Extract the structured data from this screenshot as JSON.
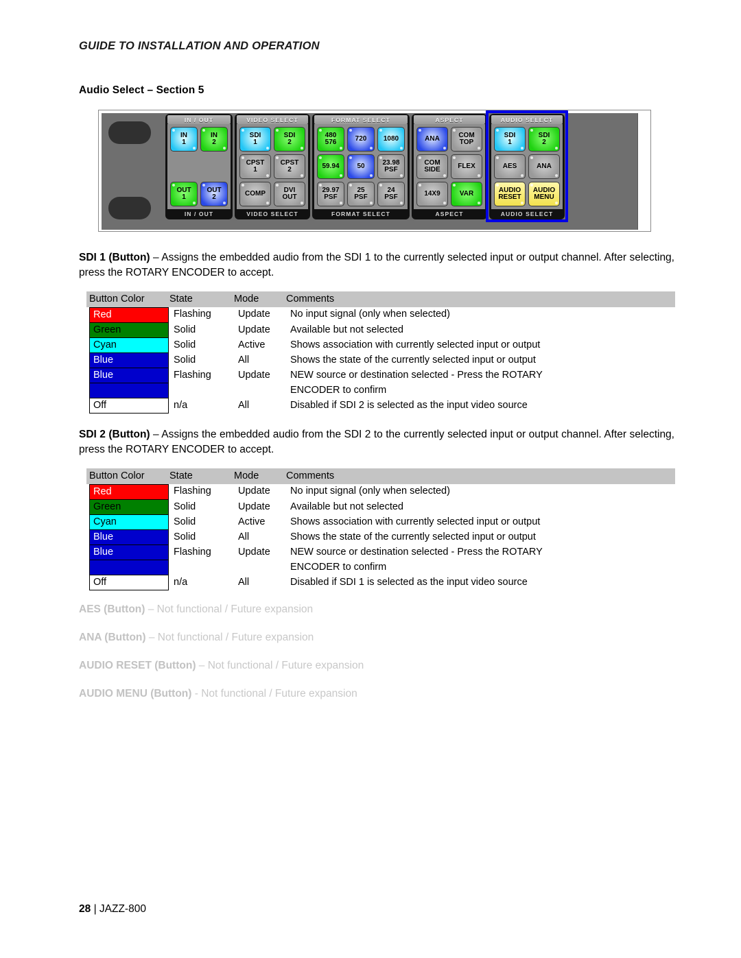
{
  "running_head": "GUIDE TO INSTALLATION AND OPERATION",
  "section_heading": "Audio Select – Section 5",
  "panel": {
    "highlight_color": "#0000e6",
    "sections": [
      {
        "id": "in-out",
        "cap_label": "IN / OUT",
        "foot_label": "IN / OUT",
        "columns": 2,
        "keys": [
          {
            "l1": "IN",
            "l2": "1",
            "color": "cyan"
          },
          {
            "l1": "IN",
            "l2": "2",
            "color": "green"
          },
          {
            "l1": "",
            "l2": "",
            "color": "blank"
          },
          {
            "l1": "",
            "l2": "",
            "color": "blank"
          },
          {
            "l1": "OUT",
            "l2": "1",
            "color": "green"
          },
          {
            "l1": "OUT",
            "l2": "2",
            "color": "blue"
          }
        ]
      },
      {
        "id": "video-select",
        "cap_label": "VIDEO SELECT",
        "foot_label": "VIDEO SELECT",
        "columns": 2,
        "keys": [
          {
            "l1": "SDI",
            "l2": "1",
            "color": "cyan"
          },
          {
            "l1": "SDI",
            "l2": "2",
            "color": "green"
          },
          {
            "l1": "CPST",
            "l2": "1",
            "color": "grey"
          },
          {
            "l1": "CPST",
            "l2": "2",
            "color": "grey"
          },
          {
            "l1": "COMP",
            "l2": "",
            "color": "grey"
          },
          {
            "l1": "DVI",
            "l2": "OUT",
            "color": "grey"
          }
        ]
      },
      {
        "id": "format-select",
        "cap_label": "FORMAT SELECT",
        "foot_label": "FORMAT SELECT",
        "columns": 3,
        "keys": [
          {
            "l1": "480",
            "l2": "576",
            "color": "green"
          },
          {
            "l1": "720",
            "l2": "",
            "color": "blue"
          },
          {
            "l1": "1080",
            "l2": "",
            "color": "cyan"
          },
          {
            "l1": "59.94",
            "l2": "",
            "color": "green"
          },
          {
            "l1": "50",
            "l2": "",
            "color": "blue"
          },
          {
            "l1": "23.98",
            "l2": "PSF",
            "color": "grey"
          },
          {
            "l1": "29.97",
            "l2": "PSF",
            "color": "grey"
          },
          {
            "l1": "25",
            "l2": "PSF",
            "color": "grey"
          },
          {
            "l1": "24",
            "l2": "PSF",
            "color": "grey"
          }
        ]
      },
      {
        "id": "aspect",
        "cap_label": "ASPECT",
        "foot_label": "ASPECT",
        "columns": 2,
        "keys": [
          {
            "l1": "ANA",
            "l2": "",
            "color": "blue"
          },
          {
            "l1": "COM",
            "l2": "TOP",
            "color": "grey"
          },
          {
            "l1": "COM",
            "l2": "SIDE",
            "color": "grey"
          },
          {
            "l1": "FLEX",
            "l2": "",
            "color": "grey"
          },
          {
            "l1": "14X9",
            "l2": "",
            "color": "grey"
          },
          {
            "l1": "VAR",
            "l2": "",
            "color": "green"
          }
        ]
      },
      {
        "id": "audio-select",
        "cap_label": "AUDIO SELECT",
        "foot_label": "AUDIO SELECT",
        "columns": 2,
        "highlighted": true,
        "keys": [
          {
            "l1": "SDI",
            "l2": "1",
            "color": "cyan"
          },
          {
            "l1": "SDI",
            "l2": "2",
            "color": "green"
          },
          {
            "l1": "AES",
            "l2": "",
            "color": "grey"
          },
          {
            "l1": "ANA",
            "l2": "",
            "color": "grey"
          },
          {
            "l1": "AUDIO",
            "l2": "RESET",
            "color": "yellow"
          },
          {
            "l1": "AUDIO",
            "l2": "MENU",
            "color": "yellow"
          }
        ]
      }
    ]
  },
  "sdi1": {
    "term": "SDI 1 (Button)",
    "dash": " – ",
    "description": "Assigns the embedded audio from the SDI 1 to the currently selected input or output channel. After selecting, press the ROTARY ENCODER to accept."
  },
  "sdi2": {
    "term": "SDI 2 (Button)",
    "dash": " – ",
    "description": "Assigns the embedded audio from the SDI 2 to the currently selected input or output channel. After selecting, press the ROTARY ENCODER to accept."
  },
  "table_headers": [
    "Button Color",
    "State",
    "Mode",
    "Comments"
  ],
  "table_sdi1": {
    "rows": [
      {
        "color_label": "Red",
        "bg": "#ff0000",
        "fg": "#ffffff",
        "state": "Flashing",
        "mode": "Update",
        "comments": "No input signal (only when selected)"
      },
      {
        "color_label": "Green",
        "bg": "#008000",
        "fg": "#000000",
        "state": "Solid",
        "mode": "Update",
        "comments": "Available but not selected"
      },
      {
        "color_label": "Cyan",
        "bg": "#00ffff",
        "fg": "#000000",
        "state": "Solid",
        "mode": "Active",
        "comments": "Shows association with currently selected input or output"
      },
      {
        "color_label": "Blue",
        "bg": "#0000cc",
        "fg": "#ffffff",
        "state": "Solid",
        "mode": "All",
        "comments": "Shows the state of the currently selected input or output"
      },
      {
        "color_label": "Blue",
        "bg": "#0000cc",
        "fg": "#ffffff",
        "state": "Flashing",
        "mode": "Update",
        "comments": "NEW source or destination selected - Press the ROTARY"
      },
      {
        "color_label": "",
        "bg": "#0000cc",
        "fg": "#ffffff",
        "state": "",
        "mode": "",
        "comments": "ENCODER to confirm"
      },
      {
        "color_label": "Off",
        "bg": "#ffffff",
        "fg": "#000000",
        "state": "n/a",
        "mode": "All",
        "comments": "Disabled if SDI 2 is selected as the input video source"
      }
    ]
  },
  "table_sdi2": {
    "rows": [
      {
        "color_label": "Red",
        "bg": "#ff0000",
        "fg": "#ffffff",
        "state": "Flashing",
        "mode": "Update",
        "comments": "No input signal (only when selected)"
      },
      {
        "color_label": "Green",
        "bg": "#008000",
        "fg": "#000000",
        "state": "Solid",
        "mode": "Update",
        "comments": "Available but not selected"
      },
      {
        "color_label": "Cyan",
        "bg": "#00ffff",
        "fg": "#000000",
        "state": "Solid",
        "mode": "Active",
        "comments": "Shows association with currently selected input or output"
      },
      {
        "color_label": "Blue",
        "bg": "#0000cc",
        "fg": "#ffffff",
        "state": "Solid",
        "mode": "All",
        "comments": "Shows the state of the currently selected input or output"
      },
      {
        "color_label": "Blue",
        "bg": "#0000cc",
        "fg": "#ffffff",
        "state": "Flashing",
        "mode": "Update",
        "comments": "NEW source or destination selected - Press the ROTARY"
      },
      {
        "color_label": "",
        "bg": "#0000cc",
        "fg": "#ffffff",
        "state": "",
        "mode": "",
        "comments": "ENCODER to confirm"
      },
      {
        "color_label": "Off",
        "bg": "#ffffff",
        "fg": "#000000",
        "state": "n/a",
        "mode": "All",
        "comments": "Disabled if SDI 1 is selected as the input video source"
      }
    ]
  },
  "future_items": [
    {
      "term": "AES (Button)",
      "rest": " – Not functional / Future expansion"
    },
    {
      "term": "ANA (Button)",
      "rest": " – Not functional / Future expansion"
    },
    {
      "term": "AUDIO RESET (Button)",
      "rest": " – Not functional / Future expansion"
    },
    {
      "term": "AUDIO MENU (Button)",
      "rest": " - Not functional / Future expansion"
    }
  ],
  "footer": {
    "page": "28",
    "separator": "|",
    "model": "JAZZ-800"
  }
}
